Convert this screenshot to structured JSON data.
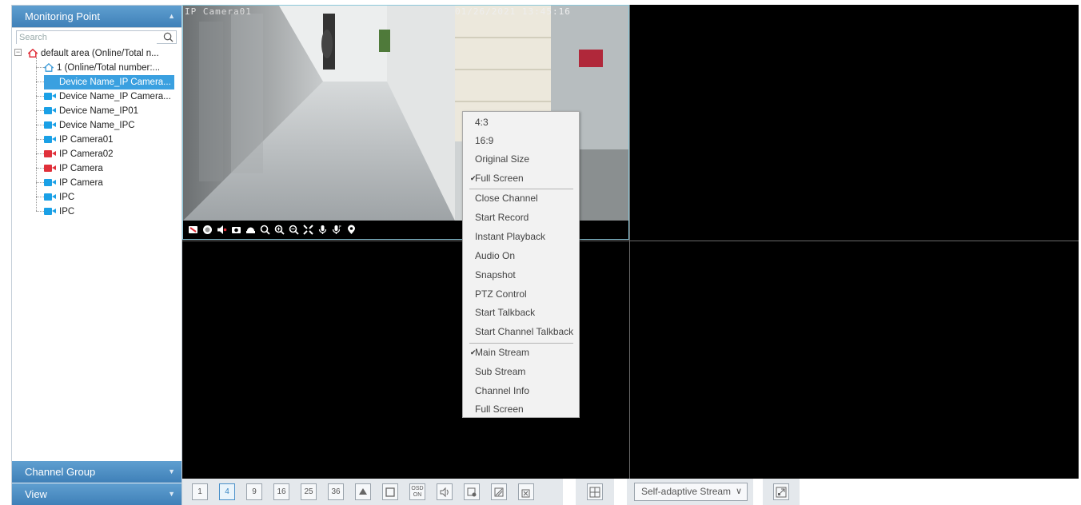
{
  "sidebar": {
    "monitoring_point": "Monitoring Point",
    "channel_group": "Channel Group",
    "view": "View",
    "search_placeholder": "Search",
    "tree": {
      "root": "default area (Online/Total n...",
      "area1": "1 (Online/Total number:...",
      "devices": [
        {
          "label": "Device Name_IP Camera...",
          "color": "#1aa0e6",
          "selected": true
        },
        {
          "label": "Device Name_IP Camera...",
          "color": "#1aa0e6",
          "selected": false
        },
        {
          "label": "Device Name_IP01",
          "color": "#1aa0e6",
          "selected": false
        },
        {
          "label": "Device Name_IPC",
          "color": "#1aa0e6",
          "selected": false
        },
        {
          "label": "IP Camera01",
          "color": "#1aa0e6",
          "selected": false
        },
        {
          "label": "IP Camera02",
          "color": "#e0303a",
          "selected": false
        },
        {
          "label": "IP Camera",
          "color": "#e0303a",
          "selected": false
        },
        {
          "label": "IP Camera",
          "color": "#1aa0e6",
          "selected": false
        },
        {
          "label": "IPC",
          "color": "#1aa0e6",
          "selected": false
        },
        {
          "label": "IPC",
          "color": "#1aa0e6",
          "selected": false
        }
      ]
    }
  },
  "video": {
    "camera_name": "IP Camera01",
    "timestamp": "01/26/2021 13:45:16"
  },
  "context_menu": {
    "items": [
      {
        "label": "4:3",
        "checked": false
      },
      {
        "label": "16:9",
        "checked": false
      },
      {
        "label": "Original Size",
        "checked": false
      },
      {
        "label": "Full Screen",
        "checked": true
      },
      {
        "label": "Close Channel",
        "checked": false
      },
      {
        "label": "Start Record",
        "checked": false
      },
      {
        "label": "Instant Playback",
        "checked": false
      },
      {
        "label": "Audio On",
        "checked": false
      },
      {
        "label": "Snapshot",
        "checked": false
      },
      {
        "label": "PTZ Control",
        "checked": false
      },
      {
        "label": "Start Talkback",
        "checked": false
      },
      {
        "label": "Start Channel Talkback",
        "checked": false
      },
      {
        "label": "Main Stream",
        "checked": true
      },
      {
        "label": "Sub Stream",
        "checked": false
      },
      {
        "label": "Channel Info",
        "checked": false
      },
      {
        "label": "Full Screen",
        "checked": false
      }
    ]
  },
  "bottom_bar": {
    "layout_buttons": [
      "1",
      "4",
      "9",
      "16",
      "25",
      "36"
    ],
    "active_layout": "4",
    "osd_label": "OSD\nON",
    "stream_select": "Self-adaptive Stream"
  },
  "colors": {
    "header_blue": "#4a8cc2",
    "selected_blue": "#3aa0e0",
    "online_cam": "#1aa0e6",
    "offline_cam": "#e0303a"
  }
}
